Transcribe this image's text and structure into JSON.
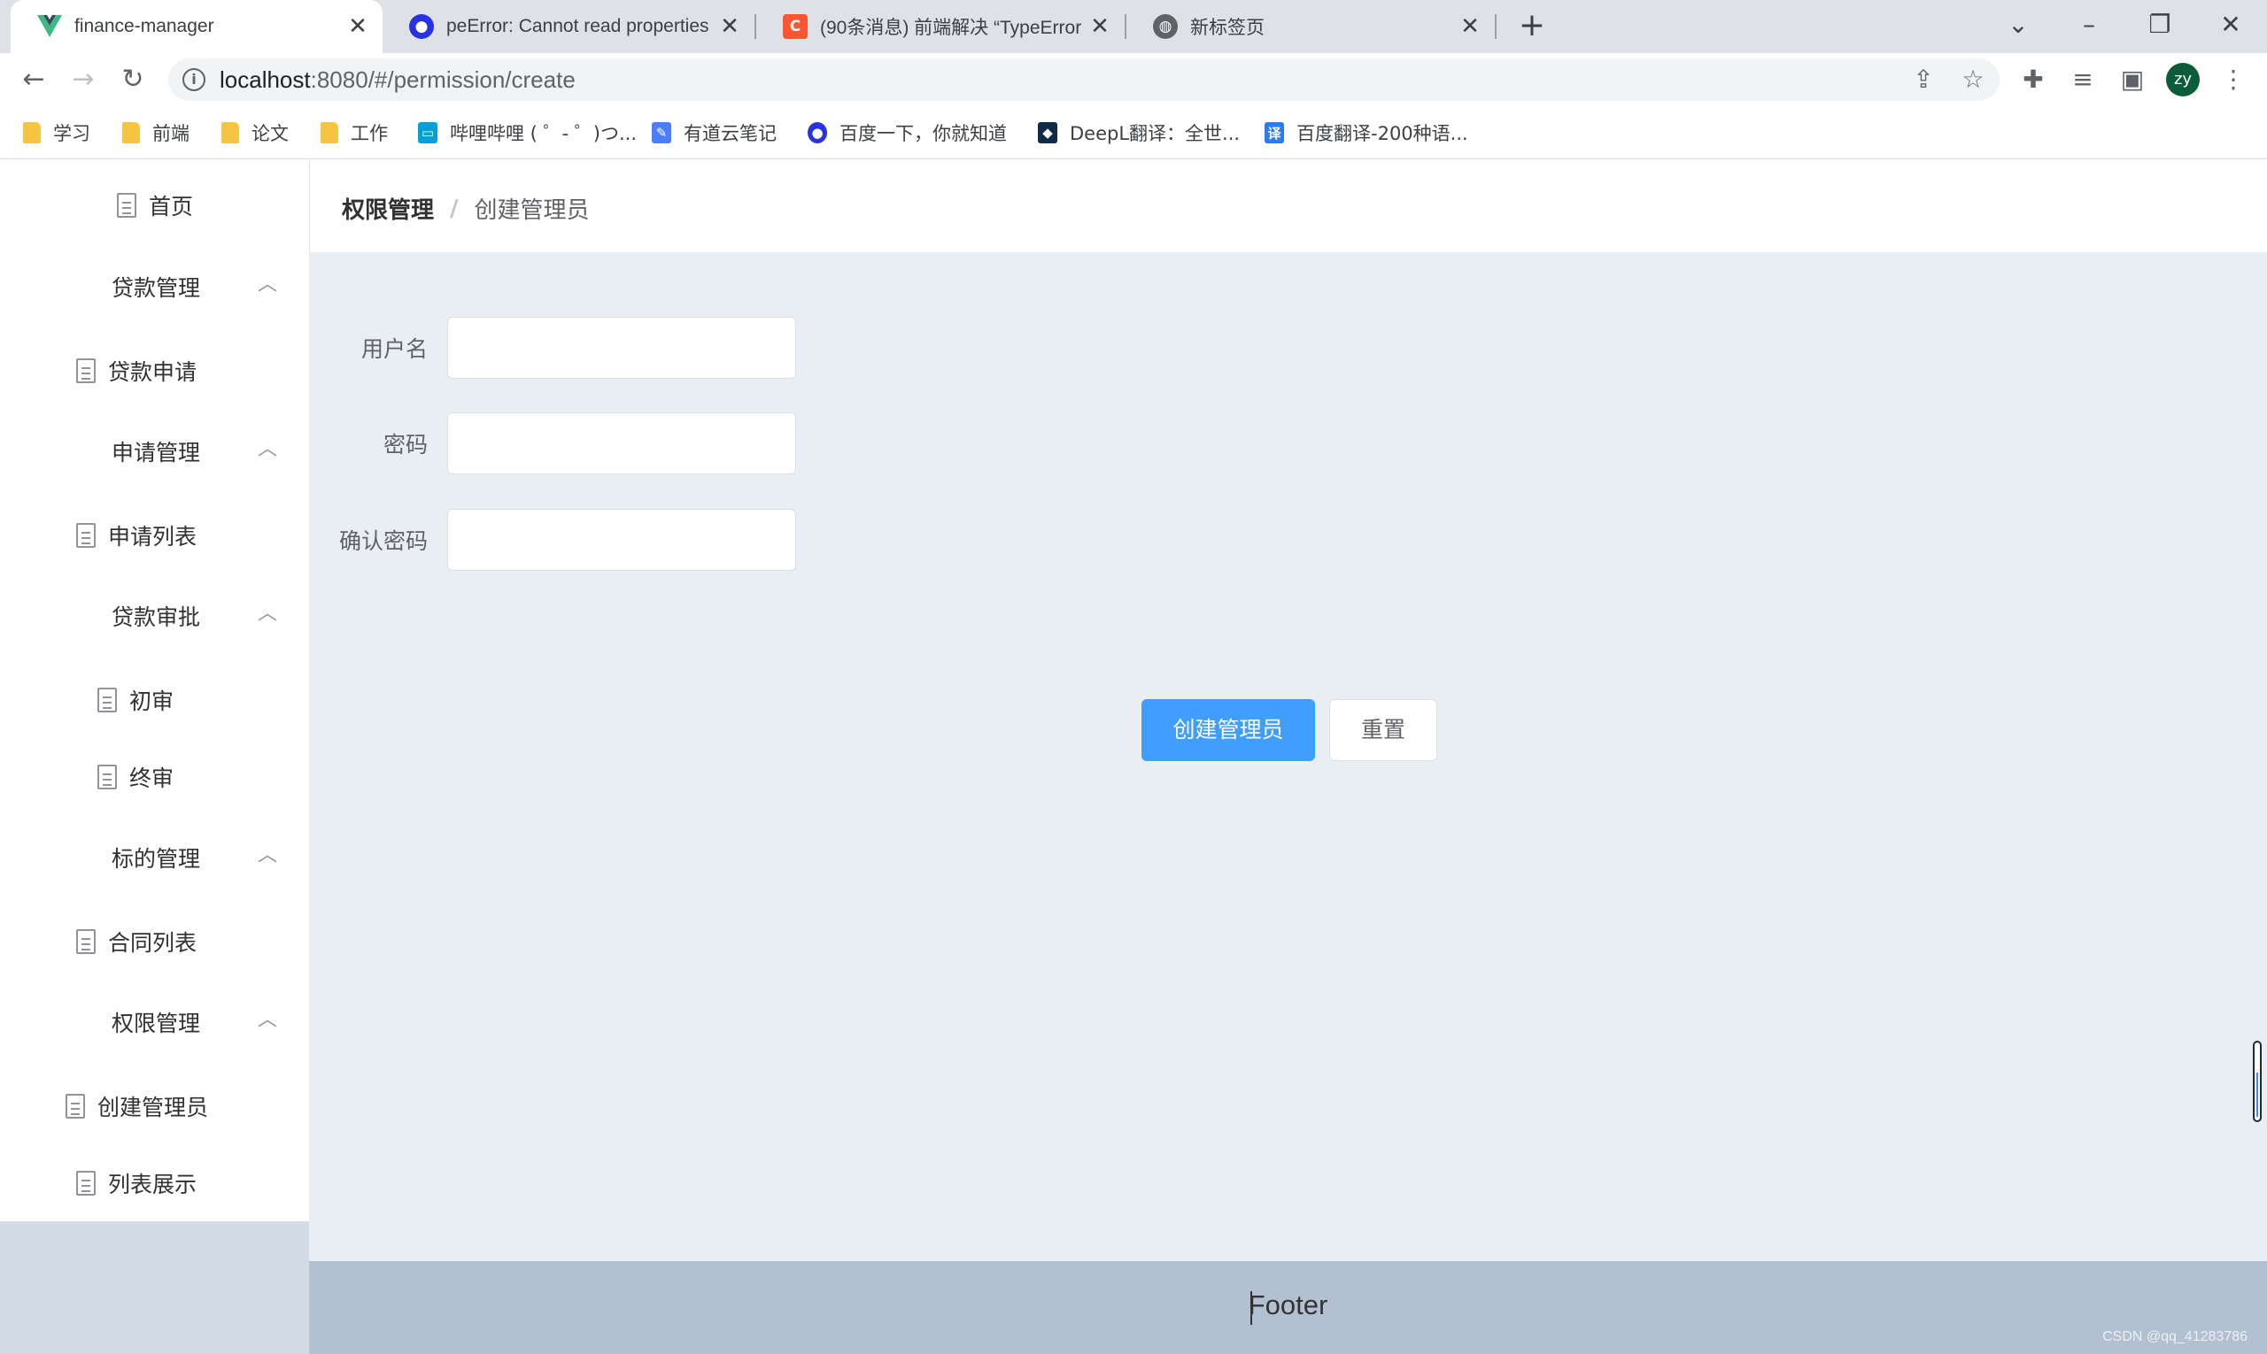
{
  "browser": {
    "tabs": [
      {
        "title": "finance-manager",
        "icon": "vue-logo-icon",
        "active": true
      },
      {
        "title": "peError: Cannot read properties",
        "icon": "baidu-paw-icon",
        "active": false
      },
      {
        "title": "(90条消息) 前端解决 “TypeError",
        "icon": "csdn-logo-icon",
        "active": false
      },
      {
        "title": "新标签页",
        "icon": "globe-icon",
        "active": false
      }
    ],
    "url_host": "localhost",
    "url_rest": ":8080/#/permission/create",
    "avatar_initials": "zy",
    "bookmarks": [
      {
        "label": "学习",
        "icon": "folder-icon"
      },
      {
        "label": "前端",
        "icon": "folder-icon"
      },
      {
        "label": "论文",
        "icon": "folder-icon"
      },
      {
        "label": "工作",
        "icon": "folder-icon"
      },
      {
        "label": "哔哩哔哩 ( ゜- ゜)つ...",
        "icon": "bilibili-icon"
      },
      {
        "label": "有道云笔记",
        "icon": "youdao-note-icon"
      },
      {
        "label": "百度一下，你就知道",
        "icon": "baidu-paw-icon"
      },
      {
        "label": "DeepL翻译：全世...",
        "icon": "deepl-icon"
      },
      {
        "label": "百度翻译-200种语...",
        "icon": "baidu-translate-icon"
      }
    ]
  },
  "sidebar": {
    "items": [
      {
        "label": "首页",
        "type": "item"
      },
      {
        "label": "贷款管理",
        "type": "submenu"
      },
      {
        "label": "贷款申请",
        "type": "item"
      },
      {
        "label": "申请管理",
        "type": "submenu"
      },
      {
        "label": "申请列表",
        "type": "item"
      },
      {
        "label": "贷款审批",
        "type": "submenu"
      },
      {
        "label": "初审",
        "type": "item"
      },
      {
        "label": "终审",
        "type": "item"
      },
      {
        "label": "标的管理",
        "type": "submenu"
      },
      {
        "label": "合同列表",
        "type": "item"
      },
      {
        "label": "权限管理",
        "type": "submenu"
      },
      {
        "label": "创建管理员",
        "type": "item"
      },
      {
        "label": "列表展示",
        "type": "item"
      }
    ]
  },
  "breadcrumb": {
    "parent": "权限管理",
    "separator": "/",
    "current": "创建管理员"
  },
  "form": {
    "username_label": "用户名",
    "username_value": "",
    "password_label": "密码",
    "password_value": "",
    "confirm_label": "确认密码",
    "confirm_value": "",
    "submit_label": "创建管理员",
    "reset_label": "重置"
  },
  "footer": {
    "text": "Footer"
  },
  "watermark": "CSDN @qq_41283786",
  "colors": {
    "primary": "#409eff",
    "main_bg": "#e9eef3",
    "footer_bg": "#b3c0d1",
    "sidebar_empty_bg": "#d3dce6"
  }
}
